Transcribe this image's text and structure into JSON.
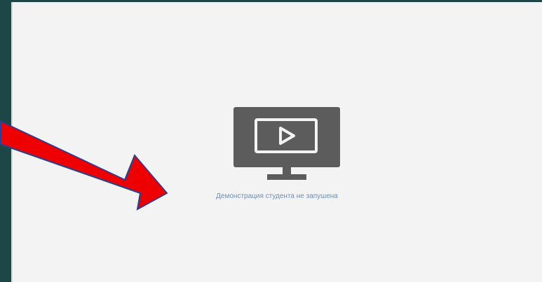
{
  "panel": {
    "status_message": "Демонстрация студента не запушена"
  },
  "icons": {
    "monitor": "monitor-play-icon"
  },
  "annotation": {
    "arrow_color": "#ee0000",
    "arrow_outline": "#2b3f8f"
  },
  "colors": {
    "background_frame": "#1d4747",
    "panel_background": "#f3f3f3",
    "icon_color": "#5c5c5c",
    "status_text_color": "#6e8fb5"
  }
}
